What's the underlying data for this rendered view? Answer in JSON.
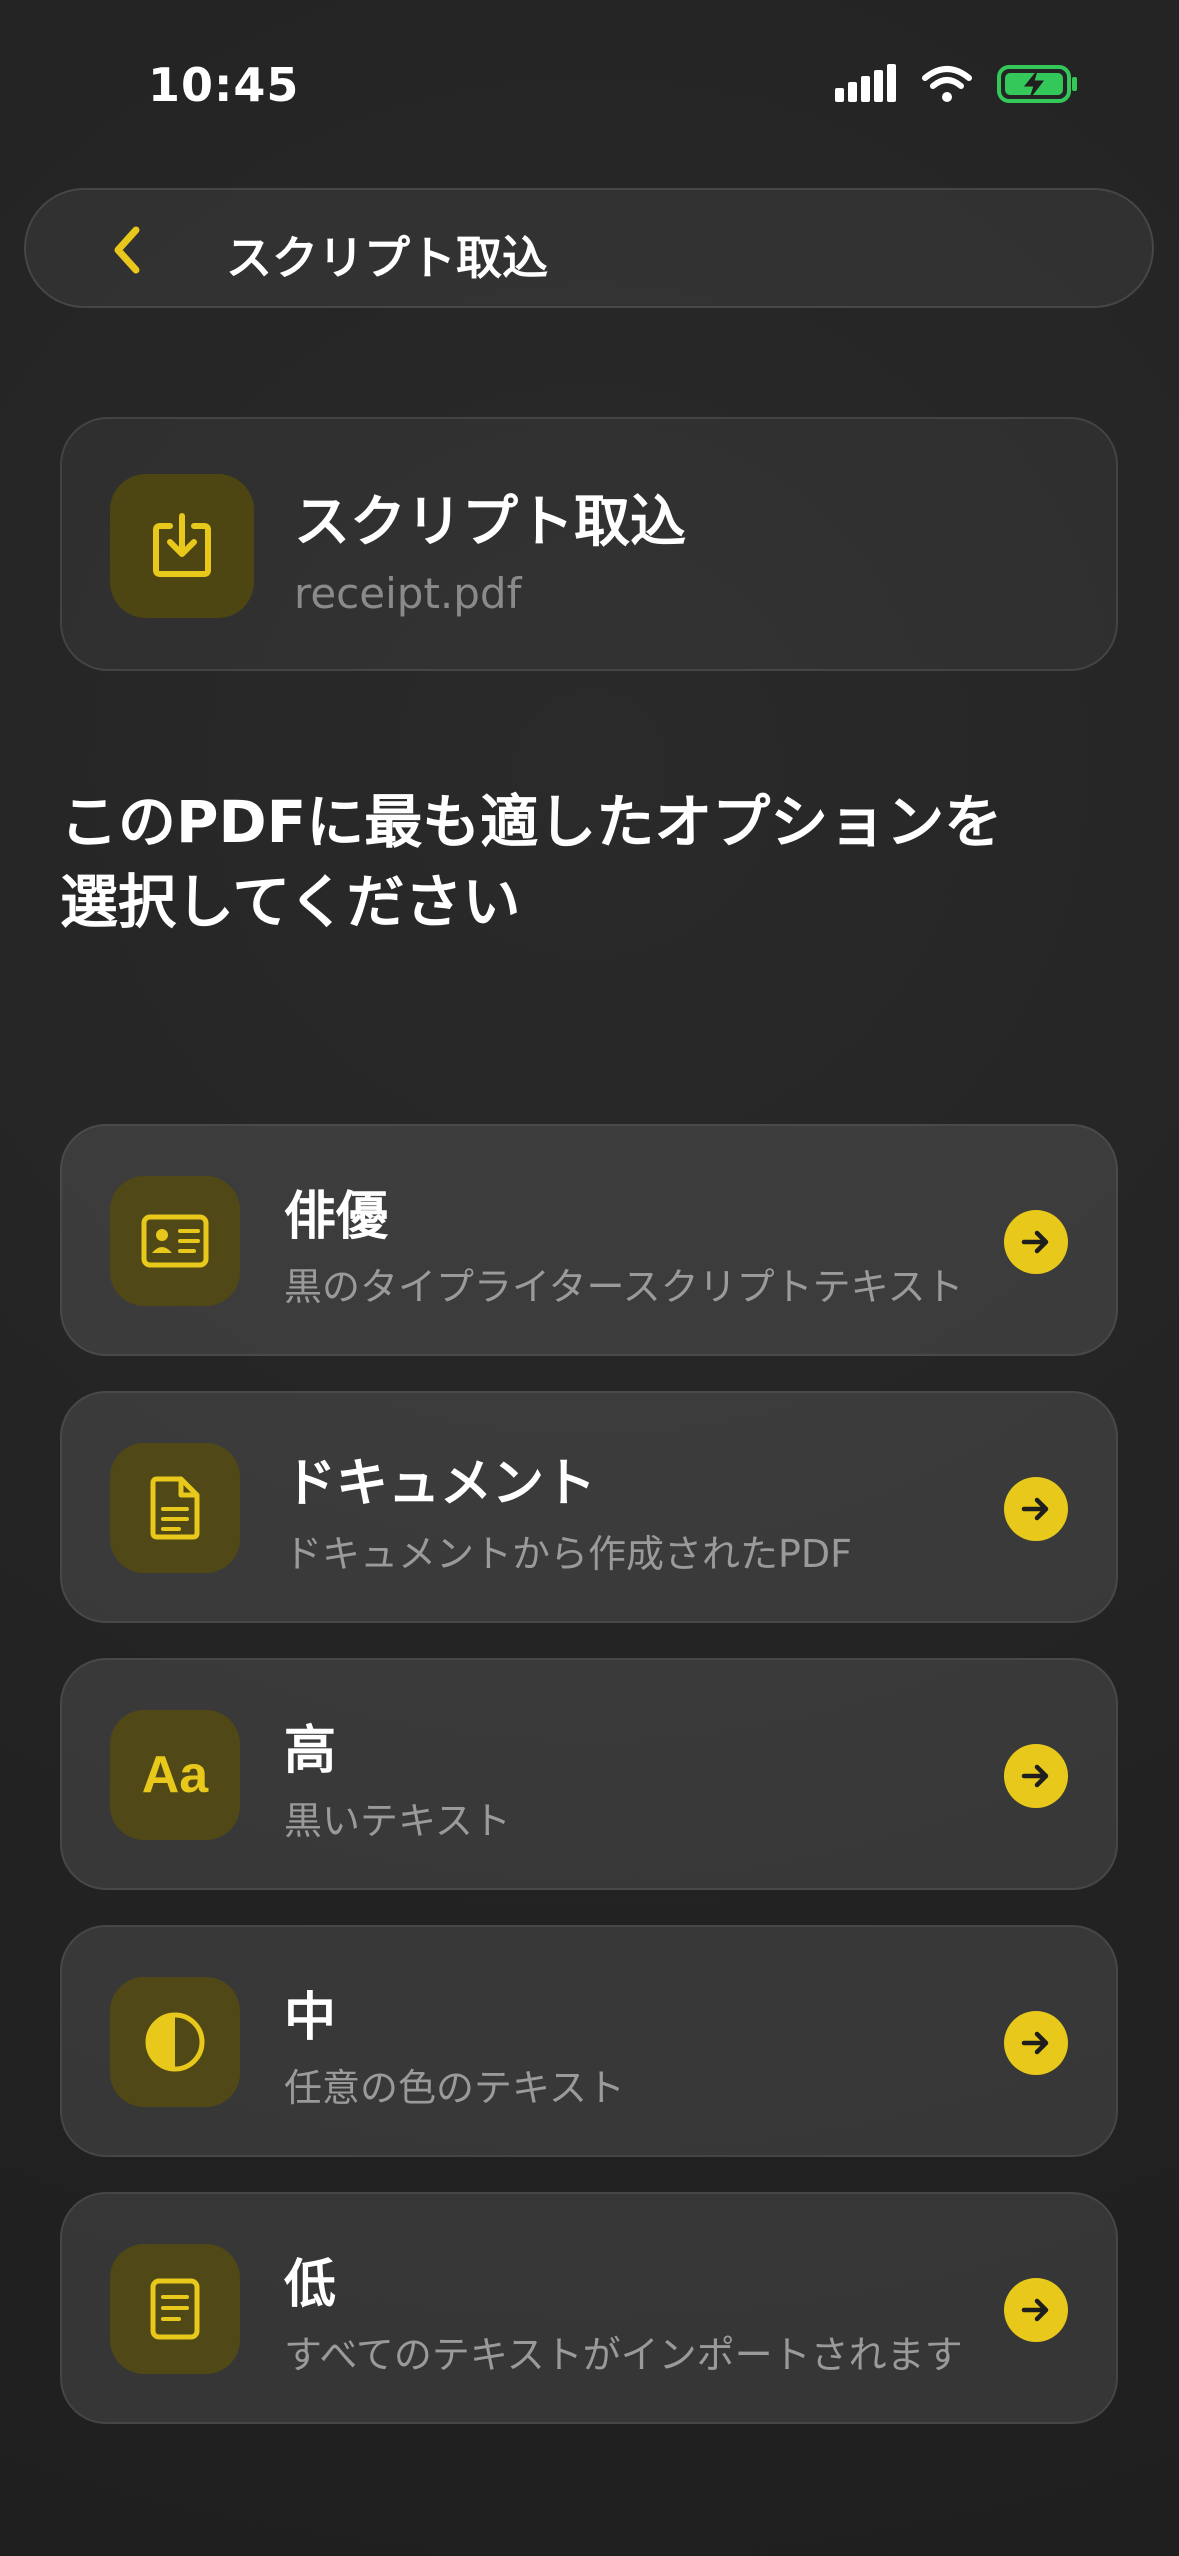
{
  "status_bar": {
    "time": "10:45"
  },
  "nav": {
    "title": "スクリプト取込"
  },
  "header": {
    "title": "スクリプト取込",
    "subtitle": "receipt.pdf"
  },
  "prompt": {
    "line1": "このPDFに最も適したオプションを",
    "line2": "選択してください"
  },
  "options": [
    {
      "title": "俳優",
      "description": "黒のタイプライタースクリプトテキスト",
      "icon": "id-card-icon"
    },
    {
      "title": "ドキュメント",
      "description": "ドキュメントから作成されたPDF",
      "icon": "document-icon"
    },
    {
      "title": "高",
      "description": "黒いテキスト",
      "icon": "text-aa-icon",
      "glyph": "Aa"
    },
    {
      "title": "中",
      "description": "任意の色のテキスト",
      "icon": "half-circle-icon"
    },
    {
      "title": "低",
      "description": "すべてのテキストがインポートされます",
      "icon": "note-icon"
    }
  ],
  "colors": {
    "accent": "#e8c81a",
    "background": "#242424",
    "battery": "#34c759"
  }
}
